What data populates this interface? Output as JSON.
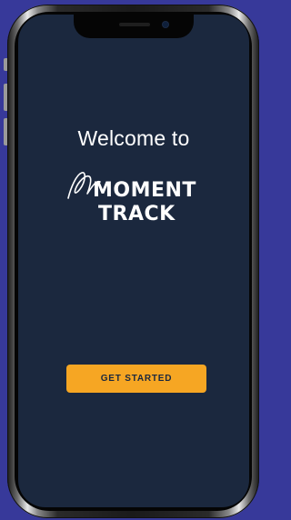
{
  "onboarding": {
    "welcome_text": "Welcome to",
    "logo": {
      "line1": "MOMENT",
      "line2": "TRACK",
      "script_mark": "M"
    },
    "cta_label": "GET STARTED"
  },
  "colors": {
    "background": "#37399a",
    "screen": "#1b283e",
    "accent": "#f6a623",
    "text": "#ffffff"
  }
}
